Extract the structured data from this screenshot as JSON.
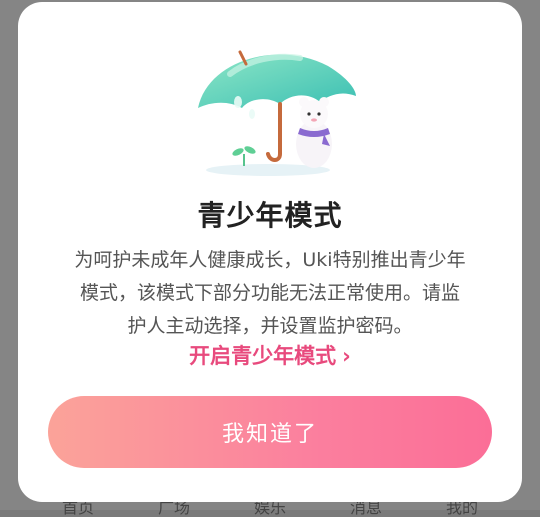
{
  "background_nav": {
    "items": [
      "首页",
      "广场",
      "娱乐",
      "消息",
      "我的"
    ]
  },
  "dialog": {
    "title": "青少年模式",
    "description": "为呵护未成年人健康成长，Uki特别推出青少年模式，该模式下部分功能无法正常使用。请监护人主动选择，并设置监护密码。",
    "link_label": "开启青少年模式",
    "confirm_label": "我知道了"
  },
  "colors": {
    "accent": "#e84a7d",
    "button_gradient_start": "#fba399",
    "button_gradient_end": "#fb6e97",
    "umbrella": "#4fd3b8"
  },
  "icons": {
    "illustration": "umbrella-bear-illustration",
    "link_chevron": "chevron-right-icon"
  }
}
